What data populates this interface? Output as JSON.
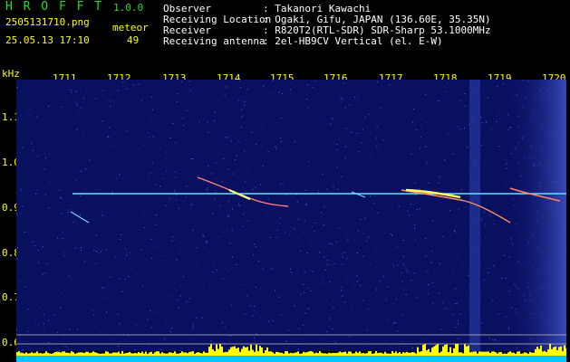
{
  "header": {
    "logo": "H R O F F T",
    "version": "1.0.0",
    "filename": "2505131710.png",
    "meteor_label": "meteor",
    "datetime": "25.05.13 17:10",
    "meteor_count": "49",
    "observer_label": "Observer",
    "observer_value": ": Takanori Kawachi",
    "location_label": "Receiving Location",
    "location_value": ": Ogaki, Gifu, JAPAN (136.60E, 35.35N)",
    "receiver_label": "Receiver",
    "receiver_value": ": R820T2(RTL-SDR) SDR-Sharp 53.1000MHz",
    "antenna_label": "Receiving antenna",
    "antenna_value": ": 2el-HB9CV Vertical (el. E-W)"
  },
  "axis": {
    "unit": "kHz",
    "x_ticks": [
      "1711",
      "1712",
      "1713",
      "1714",
      "1715",
      "1716",
      "1717",
      "1718",
      "1719",
      "1720"
    ],
    "y_ticks": [
      "1.1",
      "1.0",
      "0.9",
      "0.8",
      "0.7",
      "0.6"
    ]
  },
  "colors": {
    "background": "#0a1060",
    "carrier": "#60e0ff",
    "bottom_bars": "#ffff00",
    "bottom_base": "#00c8ff",
    "text_green": "#1ee01e",
    "text_yellow": "#ffff00"
  }
}
